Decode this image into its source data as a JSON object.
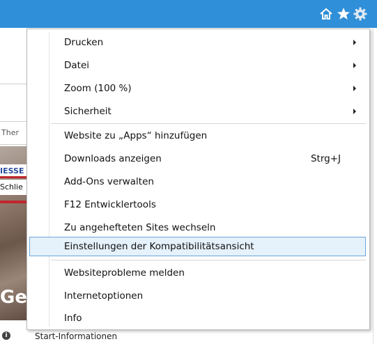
{
  "toolbar": {
    "icons": [
      "home-icon",
      "star-icon",
      "gear-icon"
    ],
    "icon_color": "#ffffff",
    "bar_color": "#2f8fd8"
  },
  "background": {
    "snippets": [
      "Ther",
      "IESSE",
      "Schlie",
      "Ge"
    ],
    "status_text": "Start-Informationen"
  },
  "menu": {
    "items": [
      {
        "label": "Drucken",
        "submenu": true
      },
      {
        "label": "Datei",
        "submenu": true
      },
      {
        "label": "Zoom (100 %)",
        "submenu": true
      },
      {
        "label": "Sicherheit",
        "submenu": true
      },
      {
        "label": "Website zu „Apps“ hinzufügen"
      },
      {
        "label": "Downloads anzeigen",
        "shortcut": "Strg+J"
      },
      {
        "label": "Add-Ons verwalten"
      },
      {
        "label": "F12 Entwicklertools"
      },
      {
        "label": "Zu angehefteten Sites wechseln"
      },
      {
        "label": "Einstellungen der Kompatibilitätsansicht",
        "highlighted": true
      },
      {
        "label": "Websiteprobleme melden"
      },
      {
        "label": "Internetoptionen"
      },
      {
        "label": "Info"
      }
    ],
    "highlight_color": "#e5f1fb"
  }
}
